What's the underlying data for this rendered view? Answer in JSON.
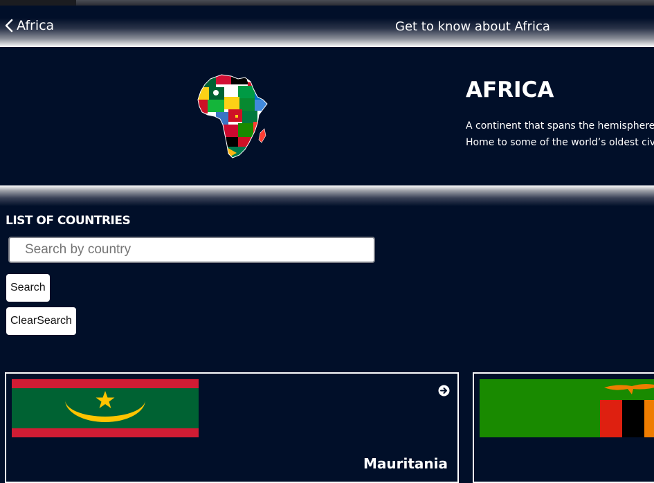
{
  "topbar": {
    "back_label": "Africa",
    "page_title": "Get to know about Africa"
  },
  "hero": {
    "title": "AFRICA",
    "description_lines": [
      "A continent that spans the hemispheres",
      "Home to some of the world’s oldest civi"
    ]
  },
  "countries": {
    "heading": "LIST OF COUNTRIES",
    "search": {
      "placeholder": "Search by country",
      "value": ""
    },
    "search_button": "Search",
    "clear_button": "ClearSearch",
    "cards": [
      {
        "name": "Mauritania",
        "flag": "mauritania-flag"
      },
      {
        "name": "",
        "flag": "zambia-flag"
      }
    ]
  },
  "colors": {
    "background": "#010f29",
    "mauritania_green": "#006233",
    "mauritania_red": "#d01c34",
    "mauritania_gold": "#ffc400",
    "zambia_green": "#198a00",
    "zambia_red": "#de2010",
    "zambia_orange": "#ef7d00"
  },
  "icons": [
    "chevron-left-icon",
    "africa-flags-map-icon",
    "arrow-right-circle-icon"
  ]
}
